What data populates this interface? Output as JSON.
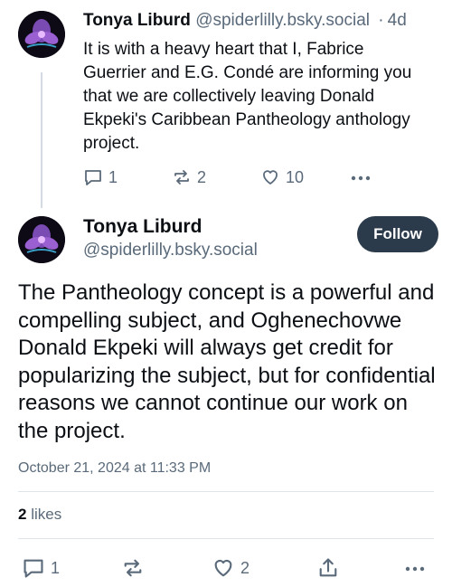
{
  "post1": {
    "author_name": "Tonya Liburd",
    "author_handle": "@spiderlilly.bsky.social",
    "separator": "·",
    "age": "4d",
    "text": "It is with a heavy heart that I, Fabrice Guerrier and E.G. Condé are informing you that we are collectively leaving Donald Ekpeki's Caribbean Pantheology anthology project.",
    "replies": "1",
    "reposts": "2",
    "likes": "10"
  },
  "post2": {
    "author_name": "Tonya Liburd",
    "author_handle": "@spiderlilly.bsky.social",
    "follow_label": "Follow",
    "text": "The Pantheology concept is a powerful and compelling subject, and Oghenechovwe Donald Ekpeki will always get credit for popularizing the subject, but for confidential reasons we cannot continue our work on the project.",
    "timestamp": "October 21, 2024 at 11:33 PM",
    "likes_count": "2",
    "likes_label": "likes",
    "replies": "1",
    "likes": "2"
  },
  "colors": {
    "text": "#0b0f14",
    "muted": "#5a6a7a",
    "follow_bg": "#2c3b4b",
    "divider": "#dfe4e9"
  },
  "icons": [
    "reply-icon",
    "repost-icon",
    "like-icon",
    "more-icon",
    "share-icon"
  ]
}
